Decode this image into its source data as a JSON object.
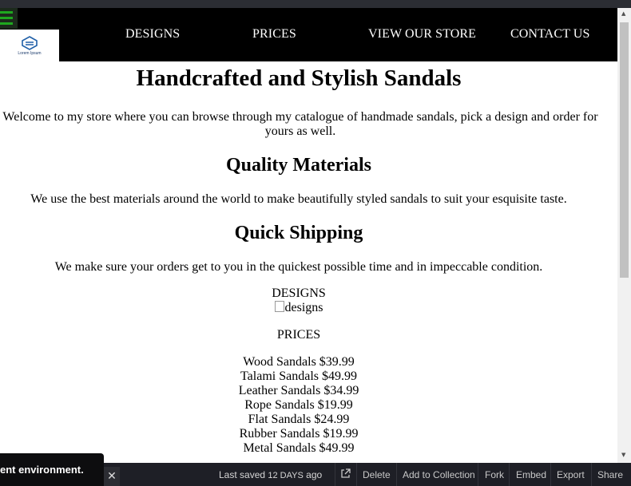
{
  "nav": {
    "links": [
      "DESIGNS",
      "PRICES",
      "VIEW OUR STORE",
      "CONTACT US"
    ],
    "logo_text": "Lorem Ipsum"
  },
  "hero": {
    "title": "Handcrafted and Stylish Sandals",
    "intro": "Welcome to my store where you can browse through my catalogue of handmade sandals, pick a design and order for yours as well."
  },
  "sections": [
    {
      "heading": "Quality Materials",
      "text": "We use the best materials around the world to make beautifully styled sandals to suit your esquisite taste."
    },
    {
      "heading": "Quick Shipping",
      "text": "We make sure your orders get to you in the quickest possible time and in impeccable condition."
    }
  ],
  "designs": {
    "label": "DESIGNS",
    "image_alt": "designs"
  },
  "prices": {
    "label": "PRICES",
    "items": [
      "Wood Sandals $39.99",
      "Talami Sandals $49.99",
      "Leather Sandals $34.99",
      "Rope Sandals $19.99",
      "Flat Sandals $24.99",
      "Rubber Sandals $19.99",
      "Metal Sandals $49.99"
    ]
  },
  "toast": {
    "text": "ent environment."
  },
  "bottombar": {
    "last_saved": "Last saved",
    "saved_ago": "12 DAYS",
    "ago": "ago",
    "actions": [
      "Delete",
      "Add to Collection",
      "Fork",
      "Embed",
      "Export",
      "Share"
    ]
  },
  "colors": {
    "navbar": "#000000",
    "bottombar": "#1e1f26",
    "hamburger": "#1fa81f"
  }
}
